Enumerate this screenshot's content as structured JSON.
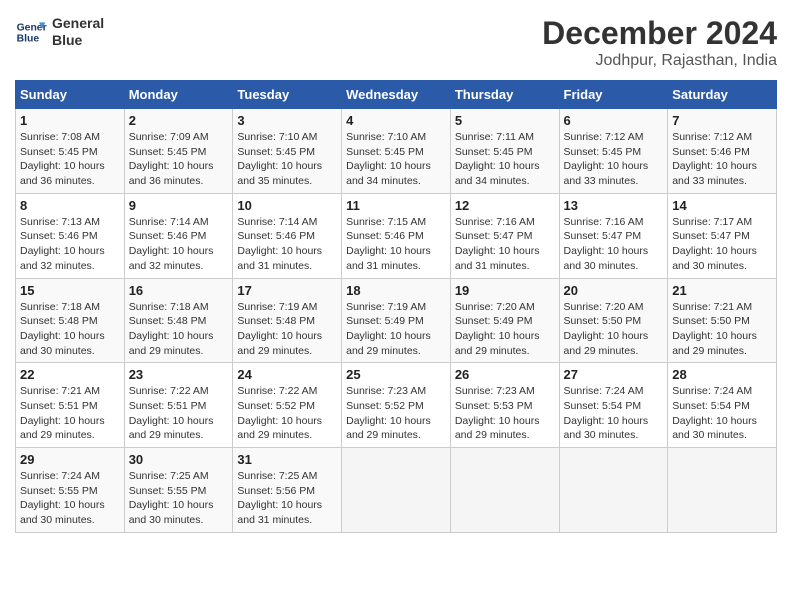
{
  "logo": {
    "line1": "General",
    "line2": "Blue"
  },
  "title": "December 2024",
  "subtitle": "Jodhpur, Rajasthan, India",
  "header_days": [
    "Sunday",
    "Monday",
    "Tuesday",
    "Wednesday",
    "Thursday",
    "Friday",
    "Saturday"
  ],
  "weeks": [
    [
      {
        "day": "1",
        "info": "Sunrise: 7:08 AM\nSunset: 5:45 PM\nDaylight: 10 hours\nand 36 minutes."
      },
      {
        "day": "2",
        "info": "Sunrise: 7:09 AM\nSunset: 5:45 PM\nDaylight: 10 hours\nand 36 minutes."
      },
      {
        "day": "3",
        "info": "Sunrise: 7:10 AM\nSunset: 5:45 PM\nDaylight: 10 hours\nand 35 minutes."
      },
      {
        "day": "4",
        "info": "Sunrise: 7:10 AM\nSunset: 5:45 PM\nDaylight: 10 hours\nand 34 minutes."
      },
      {
        "day": "5",
        "info": "Sunrise: 7:11 AM\nSunset: 5:45 PM\nDaylight: 10 hours\nand 34 minutes."
      },
      {
        "day": "6",
        "info": "Sunrise: 7:12 AM\nSunset: 5:45 PM\nDaylight: 10 hours\nand 33 minutes."
      },
      {
        "day": "7",
        "info": "Sunrise: 7:12 AM\nSunset: 5:46 PM\nDaylight: 10 hours\nand 33 minutes."
      }
    ],
    [
      {
        "day": "8",
        "info": "Sunrise: 7:13 AM\nSunset: 5:46 PM\nDaylight: 10 hours\nand 32 minutes."
      },
      {
        "day": "9",
        "info": "Sunrise: 7:14 AM\nSunset: 5:46 PM\nDaylight: 10 hours\nand 32 minutes."
      },
      {
        "day": "10",
        "info": "Sunrise: 7:14 AM\nSunset: 5:46 PM\nDaylight: 10 hours\nand 31 minutes."
      },
      {
        "day": "11",
        "info": "Sunrise: 7:15 AM\nSunset: 5:46 PM\nDaylight: 10 hours\nand 31 minutes."
      },
      {
        "day": "12",
        "info": "Sunrise: 7:16 AM\nSunset: 5:47 PM\nDaylight: 10 hours\nand 31 minutes."
      },
      {
        "day": "13",
        "info": "Sunrise: 7:16 AM\nSunset: 5:47 PM\nDaylight: 10 hours\nand 30 minutes."
      },
      {
        "day": "14",
        "info": "Sunrise: 7:17 AM\nSunset: 5:47 PM\nDaylight: 10 hours\nand 30 minutes."
      }
    ],
    [
      {
        "day": "15",
        "info": "Sunrise: 7:18 AM\nSunset: 5:48 PM\nDaylight: 10 hours\nand 30 minutes."
      },
      {
        "day": "16",
        "info": "Sunrise: 7:18 AM\nSunset: 5:48 PM\nDaylight: 10 hours\nand 29 minutes."
      },
      {
        "day": "17",
        "info": "Sunrise: 7:19 AM\nSunset: 5:48 PM\nDaylight: 10 hours\nand 29 minutes."
      },
      {
        "day": "18",
        "info": "Sunrise: 7:19 AM\nSunset: 5:49 PM\nDaylight: 10 hours\nand 29 minutes."
      },
      {
        "day": "19",
        "info": "Sunrise: 7:20 AM\nSunset: 5:49 PM\nDaylight: 10 hours\nand 29 minutes."
      },
      {
        "day": "20",
        "info": "Sunrise: 7:20 AM\nSunset: 5:50 PM\nDaylight: 10 hours\nand 29 minutes."
      },
      {
        "day": "21",
        "info": "Sunrise: 7:21 AM\nSunset: 5:50 PM\nDaylight: 10 hours\nand 29 minutes."
      }
    ],
    [
      {
        "day": "22",
        "info": "Sunrise: 7:21 AM\nSunset: 5:51 PM\nDaylight: 10 hours\nand 29 minutes."
      },
      {
        "day": "23",
        "info": "Sunrise: 7:22 AM\nSunset: 5:51 PM\nDaylight: 10 hours\nand 29 minutes."
      },
      {
        "day": "24",
        "info": "Sunrise: 7:22 AM\nSunset: 5:52 PM\nDaylight: 10 hours\nand 29 minutes."
      },
      {
        "day": "25",
        "info": "Sunrise: 7:23 AM\nSunset: 5:52 PM\nDaylight: 10 hours\nand 29 minutes."
      },
      {
        "day": "26",
        "info": "Sunrise: 7:23 AM\nSunset: 5:53 PM\nDaylight: 10 hours\nand 29 minutes."
      },
      {
        "day": "27",
        "info": "Sunrise: 7:24 AM\nSunset: 5:54 PM\nDaylight: 10 hours\nand 30 minutes."
      },
      {
        "day": "28",
        "info": "Sunrise: 7:24 AM\nSunset: 5:54 PM\nDaylight: 10 hours\nand 30 minutes."
      }
    ],
    [
      {
        "day": "29",
        "info": "Sunrise: 7:24 AM\nSunset: 5:55 PM\nDaylight: 10 hours\nand 30 minutes."
      },
      {
        "day": "30",
        "info": "Sunrise: 7:25 AM\nSunset: 5:55 PM\nDaylight: 10 hours\nand 30 minutes."
      },
      {
        "day": "31",
        "info": "Sunrise: 7:25 AM\nSunset: 5:56 PM\nDaylight: 10 hours\nand 31 minutes."
      },
      {
        "day": "",
        "info": ""
      },
      {
        "day": "",
        "info": ""
      },
      {
        "day": "",
        "info": ""
      },
      {
        "day": "",
        "info": ""
      }
    ]
  ]
}
